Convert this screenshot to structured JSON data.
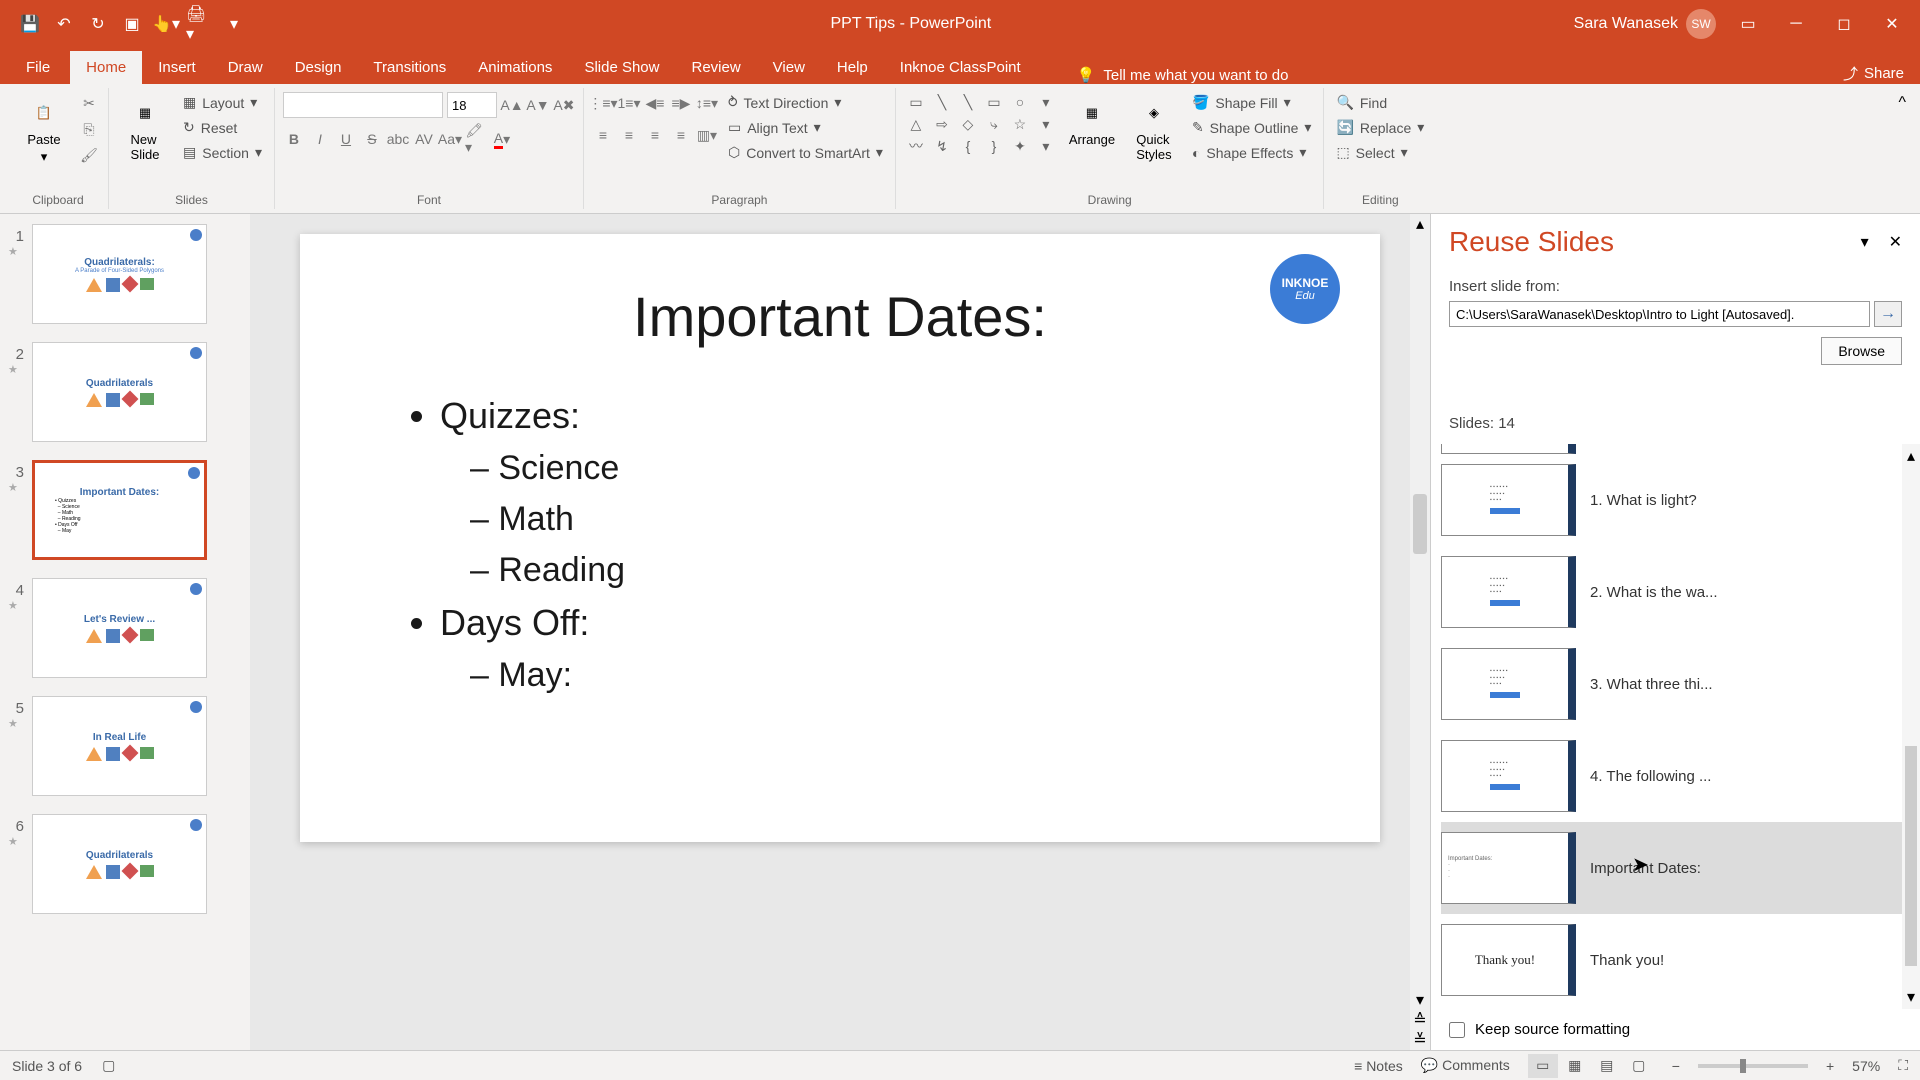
{
  "app": {
    "title": "PPT Tips  -  PowerPoint",
    "user_name": "Sara Wanasek",
    "user_initials": "SW"
  },
  "ribbon": {
    "tabs": [
      "File",
      "Home",
      "Insert",
      "Draw",
      "Design",
      "Transitions",
      "Animations",
      "Slide Show",
      "Review",
      "View",
      "Help",
      "Inknoe ClassPoint"
    ],
    "active_tab": 1,
    "tell_me": "Tell me what you want to do",
    "share": "Share",
    "groups": {
      "clipboard": {
        "label": "Clipboard",
        "paste": "Paste"
      },
      "slides": {
        "label": "Slides",
        "new_slide": "New\nSlide",
        "layout": "Layout",
        "reset": "Reset",
        "section": "Section"
      },
      "font": {
        "label": "Font",
        "size": "18"
      },
      "paragraph": {
        "label": "Paragraph",
        "text_dir": "Text Direction",
        "align_text": "Align Text",
        "smartart": "Convert to SmartArt"
      },
      "drawing": {
        "label": "Drawing",
        "arrange": "Arrange",
        "quick_styles": "Quick\nStyles",
        "fill": "Shape Fill",
        "outline": "Shape Outline",
        "effects": "Shape Effects"
      },
      "editing": {
        "label": "Editing",
        "find": "Find",
        "replace": "Replace",
        "select": "Select"
      }
    }
  },
  "thumbnails": [
    {
      "num": "1",
      "title": "Quadrilaterals:",
      "sub": "A Parade of Four-Sided Polygons",
      "shapes": true
    },
    {
      "num": "2",
      "title": "Quadrilaterals",
      "sub": "",
      "shapes": true
    },
    {
      "num": "3",
      "title": "Important Dates:",
      "sub": "",
      "shapes": false
    },
    {
      "num": "4",
      "title": "Let's Review ...",
      "sub": "",
      "shapes": true
    },
    {
      "num": "5",
      "title": "In Real Life",
      "sub": "",
      "shapes": true
    },
    {
      "num": "6",
      "title": "Quadrilaterals",
      "sub": "",
      "shapes": true
    }
  ],
  "selected_thumb": 2,
  "slide": {
    "title": "Important Dates:",
    "inknoe_top": "INKNOE",
    "inknoe_sub": "Edu",
    "bullets": [
      {
        "text": "Quizzes:",
        "sub": [
          "Science",
          "Math",
          "Reading"
        ]
      },
      {
        "text": "Days Off:",
        "sub": [
          "May:"
        ]
      }
    ]
  },
  "reuse": {
    "title": "Reuse Slides",
    "insert_from": "Insert slide from:",
    "path": "C:\\Users\\SaraWanasek\\Desktop\\Intro to Light [Autosaved].",
    "browse": "Browse",
    "count_label": "Slides: 14",
    "items": [
      {
        "label": "1. What is light?"
      },
      {
        "label": "2. What is the wa..."
      },
      {
        "label": "3. What three thi..."
      },
      {
        "label": "4. The following ..."
      },
      {
        "label": "Important Dates:"
      },
      {
        "label": "Thank you!"
      }
    ],
    "hovered": 4,
    "keep_fmt": "Keep source formatting"
  },
  "status": {
    "slide_info": "Slide 3 of 6",
    "notes": "Notes",
    "comments": "Comments",
    "zoom": "57%"
  }
}
